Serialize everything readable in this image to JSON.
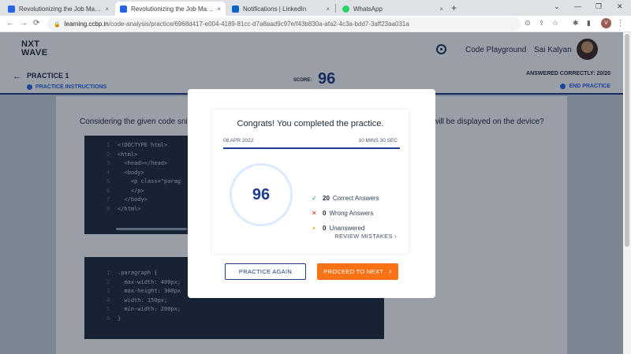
{
  "browser": {
    "tabs": [
      {
        "title": "Revolutionizing the Job Market |",
        "favicon_color": "#2563eb",
        "active": false
      },
      {
        "title": "Revolutionizing the Job Market |",
        "favicon_color": "#2563eb",
        "active": true
      },
      {
        "title": "Notifications | LinkedIn",
        "favicon_color": "#0a66c2",
        "active": false
      },
      {
        "title": "WhatsApp",
        "favicon_color": "#25d366",
        "active": false
      }
    ],
    "close_glyph": "×",
    "new_tab_glyph": "+",
    "window_controls": {
      "chevron": "⌄",
      "minimize": "—",
      "restore": "❐",
      "close": "✕"
    },
    "address": {
      "host": "learning.ccbp.in",
      "path": "/code-analysis/practice/6968d417-e004-4189-81cc-d7a8aad9c97e/f43b830a-afa2-4c3a-bdd7-3aff23aa031a"
    },
    "profile_initial": "V"
  },
  "header": {
    "logo_line1": "NXT",
    "logo_line2": "WAVE",
    "code_playground": "Code Playground",
    "username": "Sai Kalyan"
  },
  "practice_bar": {
    "title": "PRACTICE 1",
    "instructions": "PRACTICE INSTRUCTIONS",
    "score_label": "SCORE:",
    "score_value": "96",
    "answered": "ANSWERED CORRECTLY: 20/20",
    "end_practice": "END PRACTICE"
  },
  "content": {
    "question_start": "Considering the given code sni",
    "question_end": "will be displayed on the device?",
    "html_code": [
      {
        "n": "1",
        "text": "<!DOCTYPE html>"
      },
      {
        "n": "2",
        "text": "<html>"
      },
      {
        "n": "3",
        "text": "  <head></head>"
      },
      {
        "n": "4",
        "text": "  <body>"
      },
      {
        "n": "5",
        "text": "    <p class=\"parag"
      },
      {
        "n": "6",
        "text": "    </p>"
      },
      {
        "n": "7",
        "text": "  </body>"
      },
      {
        "n": "8",
        "text": "</html>"
      }
    ],
    "css_code": [
      {
        "n": "1",
        "text": ".paragraph {"
      },
      {
        "n": "2",
        "text": "  max-width: 400px;"
      },
      {
        "n": "3",
        "text": "  max-height: 300px"
      },
      {
        "n": "4",
        "text": "  width: 150px;"
      },
      {
        "n": "5",
        "text": "  min-width: 200px;"
      },
      {
        "n": "6",
        "text": "}"
      }
    ]
  },
  "modal": {
    "congrats": "Congrats! You completed the practice.",
    "date": "08 APR 2022",
    "duration": "10 MINS 30 SEC",
    "progress_fraction": 1.0,
    "score": "96",
    "stats": [
      {
        "icon": "check-icon",
        "glyph": "✓",
        "color": "#16a34a",
        "count": "20",
        "label": "Correct Answers"
      },
      {
        "icon": "cross-icon",
        "glyph": "✕",
        "color": "#dc2626",
        "count": "0",
        "label": "Wrong Answers"
      },
      {
        "icon": "dot-icon",
        "glyph": "●",
        "color": "#eab308",
        "count": "0",
        "label": "Unanswered"
      }
    ],
    "review_mistakes": "REVIEW MISTAKES",
    "practice_again": "PRACTICE AGAIN",
    "proceed_next": "PROCEED TO NEXT"
  },
  "colors": {
    "accent": "#1e3a8a",
    "link": "#2563eb",
    "cta": "#f97316"
  }
}
